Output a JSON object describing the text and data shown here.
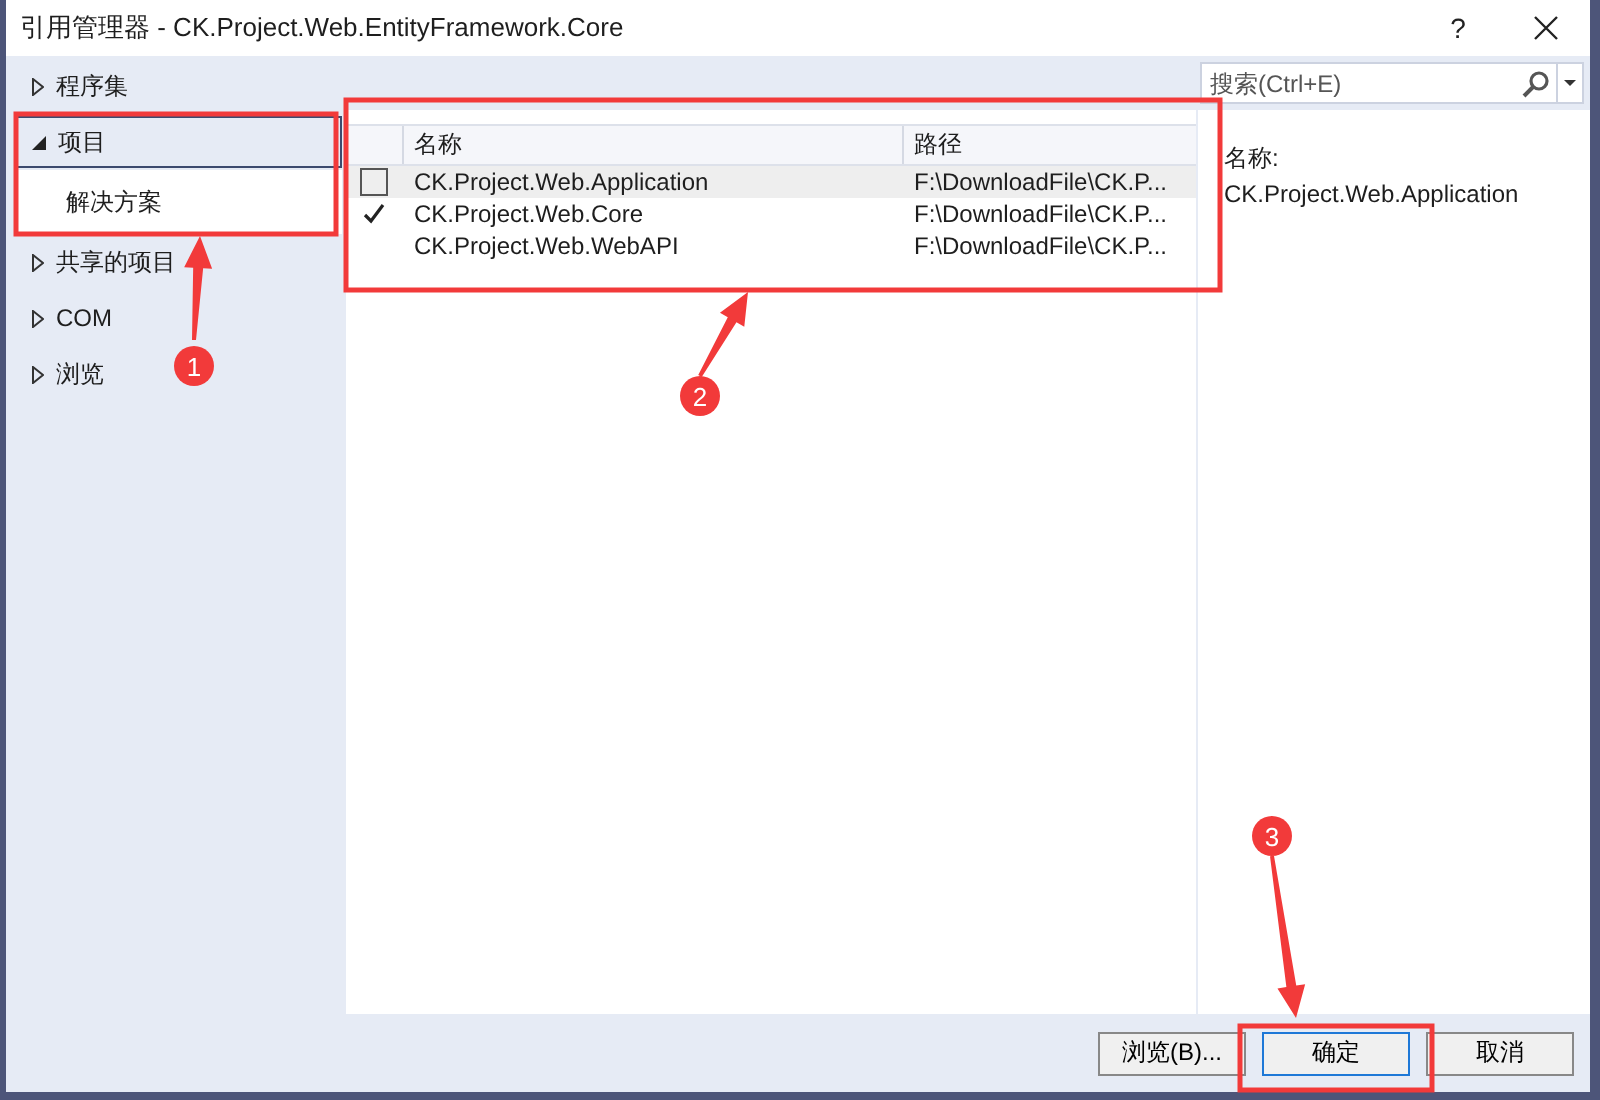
{
  "window": {
    "title": "引用管理器 - CK.Project.Web.EntityFramework.Core",
    "help": "?"
  },
  "sidebar": {
    "items": [
      {
        "label": "程序集",
        "expanded": false,
        "focused": false
      },
      {
        "label": "项目",
        "expanded": true,
        "focused": true,
        "children": [
          {
            "label": "解决方案",
            "selected": true
          }
        ]
      },
      {
        "label": "共享的项目",
        "expanded": false,
        "focused": false
      },
      {
        "label": "COM",
        "expanded": false,
        "focused": false
      },
      {
        "label": "浏览",
        "expanded": false,
        "focused": false
      }
    ]
  },
  "search": {
    "placeholder": "搜索(Ctrl+E)"
  },
  "table": {
    "columns": [
      "名称",
      "路径"
    ],
    "rows": [
      {
        "kind": "checkbox",
        "checked": false,
        "selected": true,
        "name": "CK.Project.Web.Application",
        "path": "F:\\DownloadFile\\CK.P..."
      },
      {
        "kind": "checkbox",
        "checked": true,
        "selected": false,
        "name": "CK.Project.Web.Core",
        "path": "F:\\DownloadFile\\CK.P..."
      },
      {
        "kind": "plain",
        "selected": false,
        "name": "CK.Project.Web.WebAPI",
        "path": "F:\\DownloadFile\\CK.P..."
      }
    ]
  },
  "details": {
    "label": "名称:",
    "value": "CK.Project.Web.Application"
  },
  "buttons": [
    {
      "label": "浏览(B)...",
      "default": false
    },
    {
      "label": "确定",
      "default": true
    },
    {
      "label": "取消",
      "default": false
    }
  ],
  "step_markers": [
    {
      "label": "1"
    },
    {
      "label": "2"
    },
    {
      "label": "3"
    }
  ]
}
